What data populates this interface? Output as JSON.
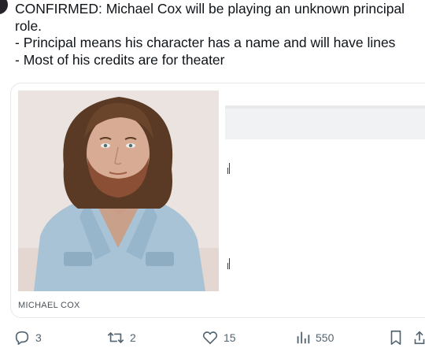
{
  "tweet": {
    "text": "CONFIRMED: Michael Cox will be playing an unknown principal\nrole.\n- Principal means his character has a name and will have lines\n- Most of his credits are for theater"
  },
  "card": {
    "photo_caption": "MICHAEL COX"
  },
  "actions": {
    "reply": {
      "icon": "reply-icon",
      "count": "3"
    },
    "retweet": {
      "icon": "retweet-icon",
      "count": "2"
    },
    "like": {
      "icon": "heart-icon",
      "count": "15"
    },
    "views": {
      "icon": "views-chart-icon",
      "count": "550"
    },
    "bookmark": {
      "icon": "bookmark-icon"
    },
    "share": {
      "icon": "share-icon"
    }
  },
  "colors": {
    "text": "#0f1419",
    "muted": "#536471",
    "card_border": "#e3e8ec"
  }
}
